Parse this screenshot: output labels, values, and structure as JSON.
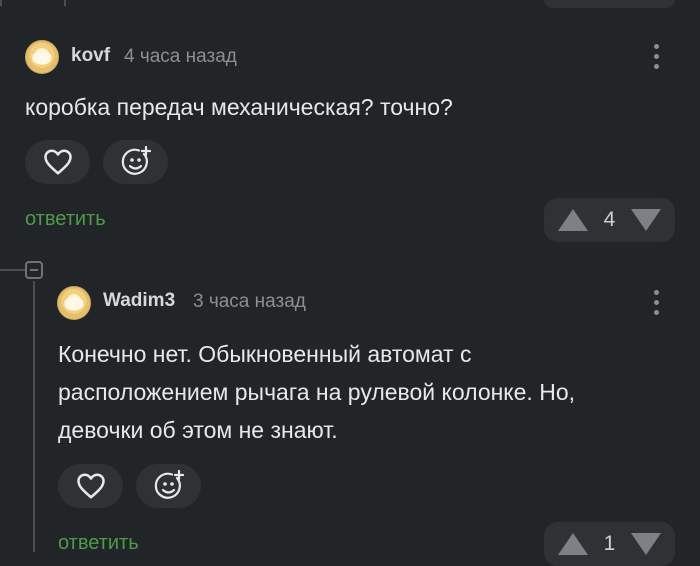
{
  "comments": [
    {
      "username": "kovf",
      "time": "4 часа назад",
      "text": "коробка передач механическая? точно?",
      "reply_label": "ответить",
      "rating": "4"
    },
    {
      "username": "Wadim3",
      "time": "3 часа назад",
      "text": "Конечно нет. Обыкновенный автомат с\nрасположением рычага на рулевой колонке. Но,\nдевочки об этом не знают.",
      "reply_label": "ответить",
      "rating": "1"
    }
  ],
  "colors": {
    "background": "#222527",
    "reply_green": "#4e9a4a",
    "pill": "#2f3235"
  },
  "icons": [
    "heart-icon",
    "add-emoji-icon",
    "more-vertical-icon",
    "arrow-up-icon",
    "arrow-down-icon",
    "collapse-icon"
  ]
}
